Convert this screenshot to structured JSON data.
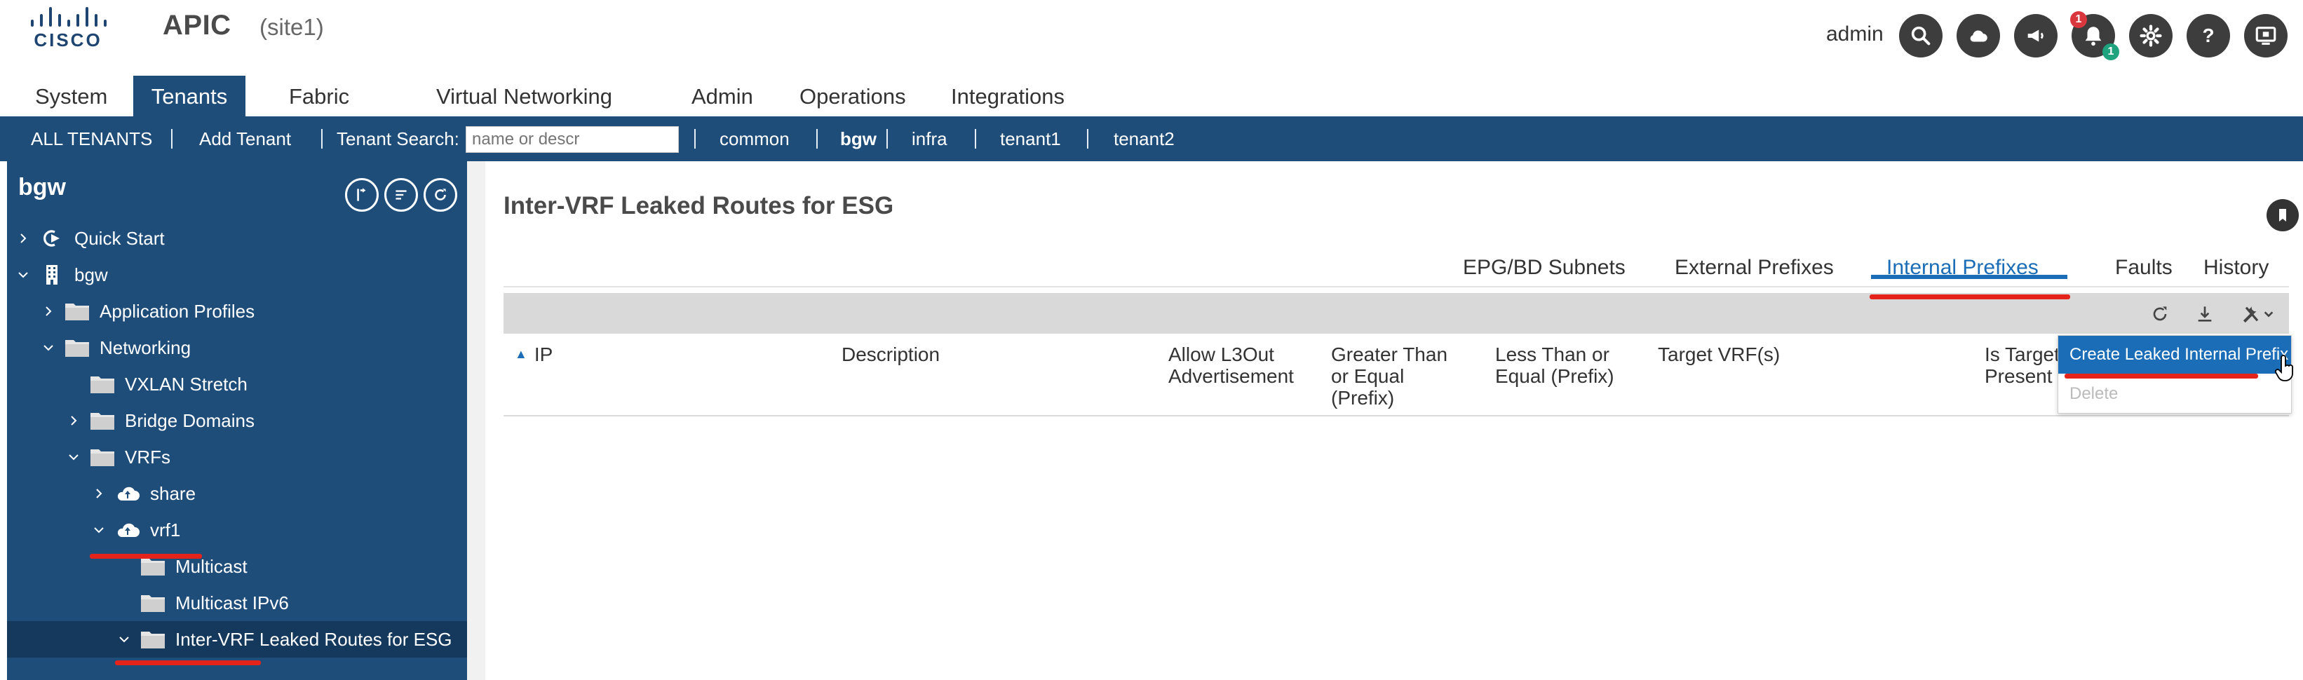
{
  "header": {
    "logo_text": "CISCO",
    "app_title": "APIC",
    "site": "(site1)",
    "user": "admin",
    "notification_badge": "1",
    "notification_sub_badge": "1",
    "icons": [
      "search-icon",
      "cloud-icon",
      "announcement-icon",
      "notification-bell-icon",
      "settings-gear-icon",
      "help-icon",
      "screen-icon"
    ]
  },
  "main_nav": {
    "tabs": [
      "System",
      "Tenants",
      "Fabric",
      "Virtual Networking",
      "Admin",
      "Operations",
      "Integrations"
    ],
    "active": "Tenants"
  },
  "sub_nav": {
    "all_tenants": "ALL TENANTS",
    "add_tenant": "Add Tenant",
    "search_label": "Tenant Search:",
    "search_placeholder": "name or descr",
    "tenants": [
      "common",
      "bgw",
      "infra",
      "tenant1",
      "tenant2"
    ],
    "active_tenant": "bgw"
  },
  "tree": {
    "title": "bgw",
    "nodes": [
      {
        "label": "Quick Start",
        "icon": "quick-start-icon",
        "expand": "collapsed"
      },
      {
        "label": "bgw",
        "icon": "building-icon",
        "expand": "expanded"
      },
      {
        "label": "Application Profiles",
        "icon": "folder-icon",
        "expand": "collapsed"
      },
      {
        "label": "Networking",
        "icon": "folder-icon",
        "expand": "expanded"
      },
      {
        "label": "VXLAN Stretch",
        "icon": "folder-icon",
        "expand": "none"
      },
      {
        "label": "Bridge Domains",
        "icon": "folder-icon",
        "expand": "collapsed"
      },
      {
        "label": "VRFs",
        "icon": "folder-icon",
        "expand": "expanded"
      },
      {
        "label": "share",
        "icon": "vrf-cloud-icon",
        "expand": "collapsed"
      },
      {
        "label": "vrf1",
        "icon": "vrf-cloud-icon",
        "expand": "expanded"
      },
      {
        "label": "Multicast",
        "icon": "folder-icon",
        "expand": "none"
      },
      {
        "label": "Multicast IPv6",
        "icon": "folder-icon",
        "expand": "none"
      },
      {
        "label": "Inter-VRF Leaked Routes for ESG",
        "icon": "folder-icon",
        "expand": "expanded"
      }
    ]
  },
  "content": {
    "title": "Inter-VRF Leaked Routes for ESG",
    "tabs": [
      "EPG/BD Subnets",
      "External Prefixes",
      "Internal Prefixes",
      "Faults",
      "History"
    ],
    "active_tab": "Internal Prefixes",
    "columns": [
      "IP",
      "Description",
      "Allow L3Out Advertisement",
      "Greater Than or Equal (Prefix)",
      "Less Than or Equal (Prefix)",
      "Target VRF(s)",
      "Is Target Present"
    ],
    "menu": {
      "create": "Create Leaked Internal Prefix",
      "delete": "Delete"
    }
  },
  "colors": {
    "nav_blue": "#1f4d7a",
    "accent_blue": "#1a6db6",
    "annotation_red": "#e4231b"
  }
}
